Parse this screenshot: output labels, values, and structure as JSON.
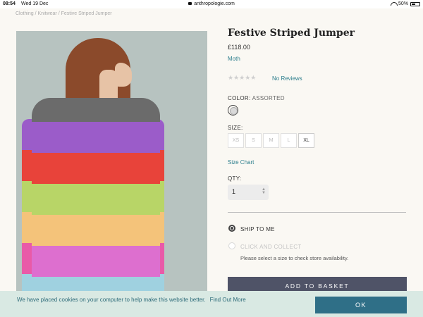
{
  "status_bar": {
    "time": "08:54",
    "date": "Wed 19 Dec",
    "url": "anthropologie.com",
    "battery": "50%"
  },
  "breadcrumb": "Clothing  /  Knitwear  /  Festive Striped Jumper",
  "product": {
    "title": "Festive Striped Jumper",
    "price": "£118.00",
    "brand": "Moth",
    "stars": "★★★★★",
    "reviews_link": "No Reviews",
    "color_label": "COLOR:",
    "color_value": "ASSORTED",
    "size_label": "SIZE:",
    "sizes": [
      {
        "label": "XS",
        "available": false
      },
      {
        "label": "S",
        "available": false
      },
      {
        "label": "M",
        "available": false
      },
      {
        "label": "L",
        "available": false
      },
      {
        "label": "XL",
        "available": true
      }
    ],
    "size_chart_link": "Size Chart",
    "qty_label": "QTY:",
    "qty_value": "1",
    "shipping": {
      "ship_label": "SHIP TO ME",
      "collect_label": "CLICK AND COLLECT",
      "collect_hint": "Please select a size to check store availability."
    },
    "add_to_basket": "ADD TO BASKET"
  },
  "cookie_banner": {
    "text": "We have placed cookies on your computer to help make this website better.",
    "link": "Find Out More",
    "ok": "OK"
  },
  "colors": {
    "accent_link": "#2b7d8c",
    "basket_button": "#4f5367",
    "ok_button": "#2f6f87",
    "cookie_bg": "#d9e9e3",
    "stripes": [
      "#6b6b6b",
      "#9b5cc9",
      "#e8433a",
      "#b8d567",
      "#f4c37a",
      "#dd6fcf",
      "#9fd1e0",
      "#e95aa8"
    ]
  }
}
